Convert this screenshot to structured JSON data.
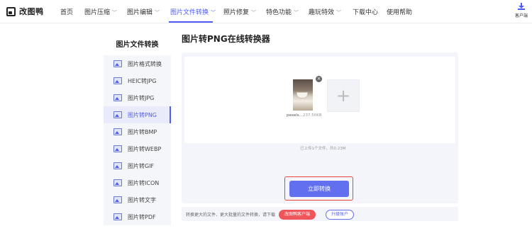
{
  "app": {
    "name": "改图鸭",
    "client_label": "客户端"
  },
  "nav": [
    {
      "label": "首页",
      "dropdown": false
    },
    {
      "label": "图片压缩",
      "dropdown": true
    },
    {
      "label": "图片编辑",
      "dropdown": true
    },
    {
      "label": "图片文件转换",
      "dropdown": true,
      "active": true
    },
    {
      "label": "照片修复",
      "dropdown": true
    },
    {
      "label": "特色功能",
      "dropdown": true
    },
    {
      "label": "趣玩特效",
      "dropdown": true
    },
    {
      "label": "下载中心",
      "dropdown": false
    },
    {
      "label": "使用帮助",
      "dropdown": false
    }
  ],
  "sidebar": {
    "title": "图片文件转换",
    "items": [
      {
        "label": "图片格式转换"
      },
      {
        "label": "HEIC转JPG"
      },
      {
        "label": "图片转JPG"
      },
      {
        "label": "图片转PNG",
        "active": true
      },
      {
        "label": "图片转BMP"
      },
      {
        "label": "图片转WEBP"
      },
      {
        "label": "图片转GIF"
      },
      {
        "label": "图片转ICON"
      },
      {
        "label": "图片转文字"
      },
      {
        "label": "图片转PDF"
      }
    ]
  },
  "main": {
    "title": "图片转PNG在线转换器",
    "file": {
      "name": "pexels...",
      "size": "237.50KB"
    },
    "upload_status": "已上传1个文件，共0.23M",
    "convert_label": "立即转换",
    "bottom_text": "转换更大的文件、更大批量的文件转换，请下载",
    "client_button": "改图鸭客户端",
    "upgrade_button": "升级账户"
  },
  "colors": {
    "accent": "#4f5cf5",
    "button": "#6270f0",
    "highlight": "#e8443a",
    "red_pill": "#f0555a"
  }
}
